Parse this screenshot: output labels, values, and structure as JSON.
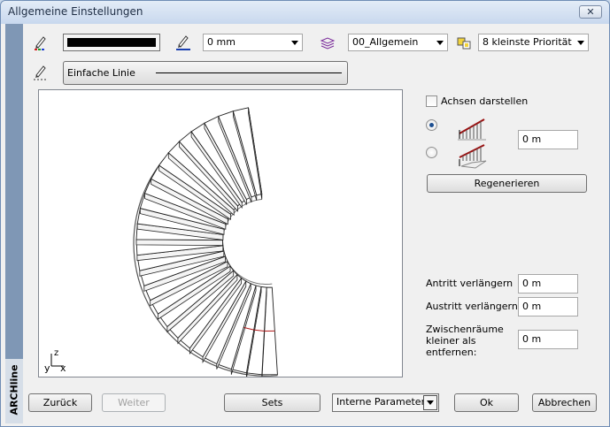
{
  "window": {
    "title": "Allgemeine Einstellungen",
    "close_glyph": "✕",
    "side_label": "ARCHline"
  },
  "toolbar": {
    "pen_color": "#000000",
    "line_width": "0 mm",
    "layer": "00_Allgemein",
    "priority": "8 kleinste Priorität",
    "line_type": "Einfache Linie"
  },
  "options": {
    "show_axes_label": "Achsen darstellen",
    "show_axes_checked": false,
    "radio_selected": 0,
    "offset_value": "0 m",
    "regenerate_label": "Regenerieren"
  },
  "params": [
    {
      "label": "Antritt verlängern",
      "value": "0 m"
    },
    {
      "label": "Austritt verlängern",
      "value": "0 m"
    },
    {
      "label": "Zwischenräume kleiner als entfernen:",
      "value": "0 m"
    }
  ],
  "footer": {
    "back": "Zurück",
    "next": "Weiter",
    "sets": "Sets",
    "internal_params": "Interne Parameter",
    "ok": "Ok",
    "cancel": "Abbrechen"
  },
  "preview": {
    "axis_labels": [
      "y",
      "x",
      "z"
    ],
    "step_count": 26
  },
  "colors": {
    "accent_red": "#b01818",
    "pen_blue": "#1a3fb0"
  },
  "icons": [
    "pencil-color-icon",
    "pencil-width-icon",
    "layers-icon",
    "priority-icon",
    "pencil-linetype-icon",
    "railing-icon"
  ]
}
